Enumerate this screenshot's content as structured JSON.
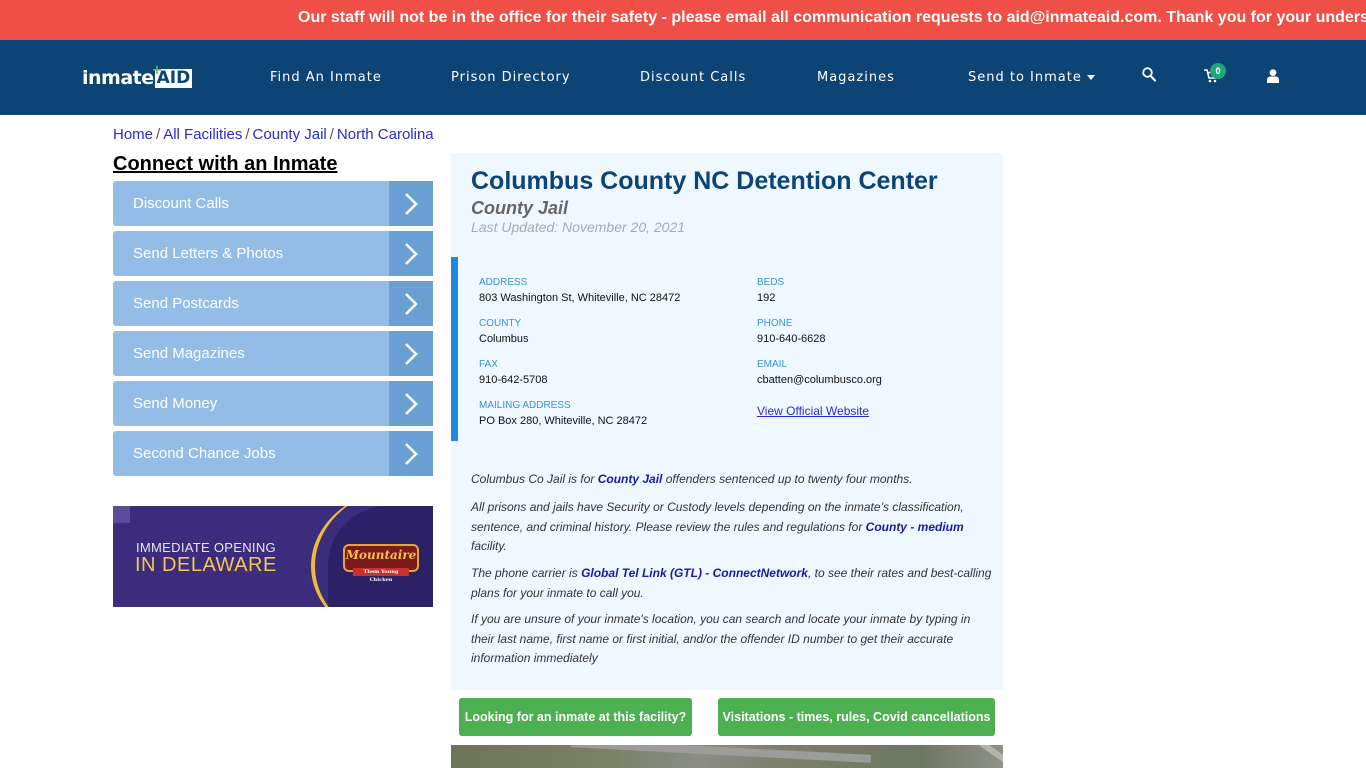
{
  "alert": {
    "text": "Our staff will not be in the office for their safety - please email all communication requests to aid@inmateaid.com. Thank you for your understanding"
  },
  "nav": {
    "logo": {
      "part1": "inmate",
      "part2": "AID",
      "plus": "+"
    },
    "items": [
      {
        "label": "Find An Inmate"
      },
      {
        "label": "Prison Directory"
      },
      {
        "label": "Discount Calls"
      },
      {
        "label": "Magazines"
      },
      {
        "label": "Send to Inmate",
        "has_dropdown": true
      }
    ],
    "icons": {
      "search": "search-icon",
      "cart": "cart-icon",
      "user": "user-icon"
    },
    "cart_count": "0"
  },
  "breadcrumb": [
    {
      "label": "Home"
    },
    {
      "label": "All Facilities"
    },
    {
      "label": "County Jail"
    },
    {
      "label": "North Carolina"
    }
  ],
  "breadcrumb_sep": "/",
  "sidebar": {
    "title": "Connect with an Inmate",
    "buttons": [
      {
        "label": "Discount Calls"
      },
      {
        "label": "Send Letters & Photos"
      },
      {
        "label": "Send Postcards"
      },
      {
        "label": "Send Magazines"
      },
      {
        "label": "Send Money"
      },
      {
        "label": "Second Chance Jobs"
      }
    ],
    "ad": {
      "line1": "IMMEDIATE OPENING",
      "line2": "IN DELAWARE",
      "brand": "Mountaire",
      "brand_sub": "Them Young Chicken"
    }
  },
  "facility": {
    "name": "Columbus County NC Detention Center",
    "type": "County Jail",
    "last_updated": "Last Updated: November 20, 2021",
    "fields": {
      "address": {
        "label": "ADDRESS",
        "value": "803 Washington St, Whiteville, NC 28472"
      },
      "beds": {
        "label": "BEDS",
        "value": "192"
      },
      "county": {
        "label": "COUNTY",
        "value": "Columbus"
      },
      "phone": {
        "label": "PHONE",
        "value": "910-640-6628"
      },
      "fax": {
        "label": "FAX",
        "value": "910-642-5708"
      },
      "email": {
        "label": "EMAIL",
        "value": "cbatten@columbusco.org"
      },
      "mailing": {
        "label": "MAILING ADDRESS",
        "value": "PO Box 280, Whiteville, NC 28472"
      },
      "website_link": "View Official Website"
    },
    "paragraphs": {
      "p1": {
        "a": "Columbus Co Jail is for ",
        "b": "County Jail",
        "c": " offenders sentenced up to twenty four months."
      },
      "p2": {
        "a": "All prisons and jails have Security or Custody levels depending on the inmate’s classification, sentence, and criminal history. Please review the rules and regulations for ",
        "b": "County - medium",
        "c": " facility."
      },
      "p3": {
        "a": "The phone carrier is ",
        "b": "Global Tel Link (GTL) - ConnectNetwork",
        "c": ", to see their rates and best-calling plans for your inmate to call you."
      },
      "p4": "If you are unsure of your inmate's location, you can search and locate your inmate by typing in their last name, first name or first initial, and/or the offender ID number to get their accurate information immediately"
    },
    "buttons": {
      "looking": "Looking for an inmate at this facility?",
      "visitations": "Visitations - times, rules, Covid cancellations"
    }
  },
  "colors": {
    "alert": "#ef4f47",
    "nav": "#0c4476",
    "side_button": "#93bde6",
    "side_arrow": "#6a9fd3",
    "card_bg": "#eef8fe",
    "accent_bar": "#1e88e5",
    "green": "#4caf50",
    "badge": "#1fa87b"
  }
}
